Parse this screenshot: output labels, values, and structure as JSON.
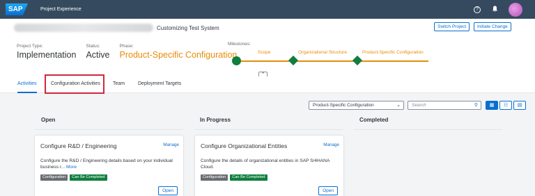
{
  "shell": {
    "logo": "SAP",
    "app_title": "Project Experience",
    "icons": [
      "help-icon",
      "bell-icon",
      "avatar"
    ]
  },
  "header": {
    "system_name": "Customizing Test System",
    "switch_project": "Switch Project",
    "initiate_change": "Initiate Change",
    "project_type_label": "Project Type:",
    "project_type_value": "Implementation",
    "status_label": "Status:",
    "status_value": "Active",
    "phase_label": "Phase:",
    "phase_value": "Product-Specific Configuration",
    "milestones_label": "Milestones:",
    "milestones": [
      "Scope",
      "Organizational Structure",
      "Product-Specific Configuration"
    ],
    "collapse_icon": "chevron-up-icon"
  },
  "tabs": [
    {
      "label": "Activities",
      "active": true
    },
    {
      "label": "Configuration Activities",
      "active": false
    },
    {
      "label": "Team",
      "active": false
    },
    {
      "label": "Deployment Targets",
      "active": false
    }
  ],
  "toolbar": {
    "phase_select": "Product-Specific Configuration",
    "search_placeholder": "Search"
  },
  "columns": {
    "open": "Open",
    "in_progress": "In Progress",
    "completed": "Completed"
  },
  "cards": [
    {
      "title": "Configure R&D / Engineering",
      "manage": "Manage",
      "description": "Configure the R&D / Engineering details based on your individual business r...",
      "more": "More",
      "badges": [
        "Configuration",
        "Can Be Completed"
      ],
      "open": "Open"
    },
    {
      "title": "Configure Organizational Entities",
      "manage": "Manage",
      "description": "Configure the details of organizational entities in SAP S/4HANA Cloud.",
      "more": "",
      "badges": [
        "Configuration",
        "Can Be Completed"
      ],
      "open": "Open"
    }
  ],
  "colors": {
    "shell": "#354a5f",
    "accent": "#0a6ed1",
    "phase_orange": "#e78c07",
    "success_green": "#107e3e",
    "highlight_red": "#d1273d"
  }
}
